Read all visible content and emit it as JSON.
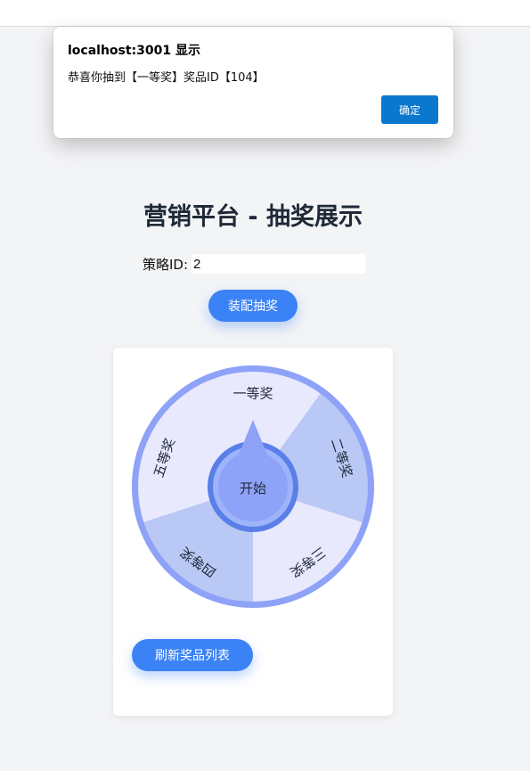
{
  "dialog": {
    "title": "localhost:3001 显示",
    "message": "恭喜你抽到【一等奖】奖品ID【104】",
    "ok_label": "确定"
  },
  "page": {
    "title": "营销平台 - 抽奖展示"
  },
  "strategy": {
    "label": "策略ID:",
    "value": "2"
  },
  "buttons": {
    "assemble_label": "装配抽奖",
    "refresh_label": "刷新奖品列表"
  },
  "wheel": {
    "center_label": "开始",
    "prizes": [
      "一等奖",
      "二等奖",
      "三等奖",
      "四等奖",
      "五等奖"
    ],
    "colors": {
      "rim": "#8ea2f8",
      "slice_light": "#e9e9fe",
      "slice_mid": "#b9c8f4",
      "button_ring": "#5a7fe8",
      "button_inner": "#9db4fb",
      "button_core": "#8ea2f8"
    }
  }
}
